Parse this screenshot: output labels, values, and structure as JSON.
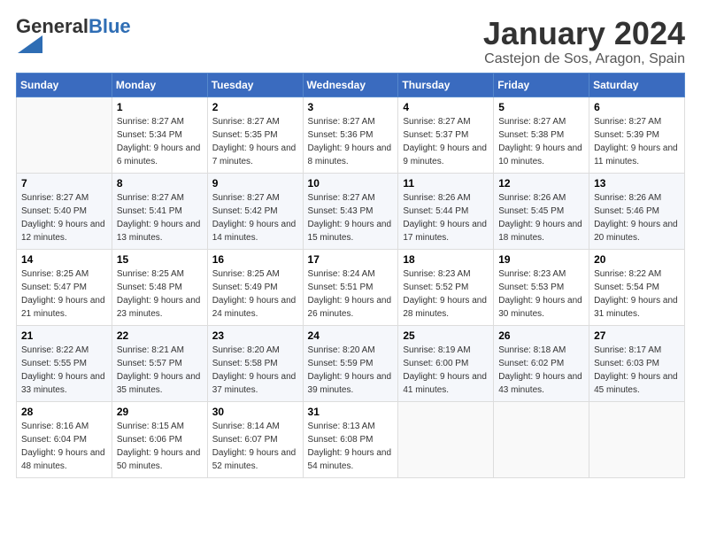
{
  "header": {
    "logo_general": "General",
    "logo_blue": "Blue",
    "title": "January 2024",
    "location": "Castejon de Sos, Aragon, Spain"
  },
  "weekdays": [
    "Sunday",
    "Monday",
    "Tuesday",
    "Wednesday",
    "Thursday",
    "Friday",
    "Saturday"
  ],
  "weeks": [
    [
      {
        "num": "",
        "sunrise": "",
        "sunset": "",
        "daylight": ""
      },
      {
        "num": "1",
        "sunrise": "Sunrise: 8:27 AM",
        "sunset": "Sunset: 5:34 PM",
        "daylight": "Daylight: 9 hours and 6 minutes."
      },
      {
        "num": "2",
        "sunrise": "Sunrise: 8:27 AM",
        "sunset": "Sunset: 5:35 PM",
        "daylight": "Daylight: 9 hours and 7 minutes."
      },
      {
        "num": "3",
        "sunrise": "Sunrise: 8:27 AM",
        "sunset": "Sunset: 5:36 PM",
        "daylight": "Daylight: 9 hours and 8 minutes."
      },
      {
        "num": "4",
        "sunrise": "Sunrise: 8:27 AM",
        "sunset": "Sunset: 5:37 PM",
        "daylight": "Daylight: 9 hours and 9 minutes."
      },
      {
        "num": "5",
        "sunrise": "Sunrise: 8:27 AM",
        "sunset": "Sunset: 5:38 PM",
        "daylight": "Daylight: 9 hours and 10 minutes."
      },
      {
        "num": "6",
        "sunrise": "Sunrise: 8:27 AM",
        "sunset": "Sunset: 5:39 PM",
        "daylight": "Daylight: 9 hours and 11 minutes."
      }
    ],
    [
      {
        "num": "7",
        "sunrise": "Sunrise: 8:27 AM",
        "sunset": "Sunset: 5:40 PM",
        "daylight": "Daylight: 9 hours and 12 minutes."
      },
      {
        "num": "8",
        "sunrise": "Sunrise: 8:27 AM",
        "sunset": "Sunset: 5:41 PM",
        "daylight": "Daylight: 9 hours and 13 minutes."
      },
      {
        "num": "9",
        "sunrise": "Sunrise: 8:27 AM",
        "sunset": "Sunset: 5:42 PM",
        "daylight": "Daylight: 9 hours and 14 minutes."
      },
      {
        "num": "10",
        "sunrise": "Sunrise: 8:27 AM",
        "sunset": "Sunset: 5:43 PM",
        "daylight": "Daylight: 9 hours and 15 minutes."
      },
      {
        "num": "11",
        "sunrise": "Sunrise: 8:26 AM",
        "sunset": "Sunset: 5:44 PM",
        "daylight": "Daylight: 9 hours and 17 minutes."
      },
      {
        "num": "12",
        "sunrise": "Sunrise: 8:26 AM",
        "sunset": "Sunset: 5:45 PM",
        "daylight": "Daylight: 9 hours and 18 minutes."
      },
      {
        "num": "13",
        "sunrise": "Sunrise: 8:26 AM",
        "sunset": "Sunset: 5:46 PM",
        "daylight": "Daylight: 9 hours and 20 minutes."
      }
    ],
    [
      {
        "num": "14",
        "sunrise": "Sunrise: 8:25 AM",
        "sunset": "Sunset: 5:47 PM",
        "daylight": "Daylight: 9 hours and 21 minutes."
      },
      {
        "num": "15",
        "sunrise": "Sunrise: 8:25 AM",
        "sunset": "Sunset: 5:48 PM",
        "daylight": "Daylight: 9 hours and 23 minutes."
      },
      {
        "num": "16",
        "sunrise": "Sunrise: 8:25 AM",
        "sunset": "Sunset: 5:49 PM",
        "daylight": "Daylight: 9 hours and 24 minutes."
      },
      {
        "num": "17",
        "sunrise": "Sunrise: 8:24 AM",
        "sunset": "Sunset: 5:51 PM",
        "daylight": "Daylight: 9 hours and 26 minutes."
      },
      {
        "num": "18",
        "sunrise": "Sunrise: 8:23 AM",
        "sunset": "Sunset: 5:52 PM",
        "daylight": "Daylight: 9 hours and 28 minutes."
      },
      {
        "num": "19",
        "sunrise": "Sunrise: 8:23 AM",
        "sunset": "Sunset: 5:53 PM",
        "daylight": "Daylight: 9 hours and 30 minutes."
      },
      {
        "num": "20",
        "sunrise": "Sunrise: 8:22 AM",
        "sunset": "Sunset: 5:54 PM",
        "daylight": "Daylight: 9 hours and 31 minutes."
      }
    ],
    [
      {
        "num": "21",
        "sunrise": "Sunrise: 8:22 AM",
        "sunset": "Sunset: 5:55 PM",
        "daylight": "Daylight: 9 hours and 33 minutes."
      },
      {
        "num": "22",
        "sunrise": "Sunrise: 8:21 AM",
        "sunset": "Sunset: 5:57 PM",
        "daylight": "Daylight: 9 hours and 35 minutes."
      },
      {
        "num": "23",
        "sunrise": "Sunrise: 8:20 AM",
        "sunset": "Sunset: 5:58 PM",
        "daylight": "Daylight: 9 hours and 37 minutes."
      },
      {
        "num": "24",
        "sunrise": "Sunrise: 8:20 AM",
        "sunset": "Sunset: 5:59 PM",
        "daylight": "Daylight: 9 hours and 39 minutes."
      },
      {
        "num": "25",
        "sunrise": "Sunrise: 8:19 AM",
        "sunset": "Sunset: 6:00 PM",
        "daylight": "Daylight: 9 hours and 41 minutes."
      },
      {
        "num": "26",
        "sunrise": "Sunrise: 8:18 AM",
        "sunset": "Sunset: 6:02 PM",
        "daylight": "Daylight: 9 hours and 43 minutes."
      },
      {
        "num": "27",
        "sunrise": "Sunrise: 8:17 AM",
        "sunset": "Sunset: 6:03 PM",
        "daylight": "Daylight: 9 hours and 45 minutes."
      }
    ],
    [
      {
        "num": "28",
        "sunrise": "Sunrise: 8:16 AM",
        "sunset": "Sunset: 6:04 PM",
        "daylight": "Daylight: 9 hours and 48 minutes."
      },
      {
        "num": "29",
        "sunrise": "Sunrise: 8:15 AM",
        "sunset": "Sunset: 6:06 PM",
        "daylight": "Daylight: 9 hours and 50 minutes."
      },
      {
        "num": "30",
        "sunrise": "Sunrise: 8:14 AM",
        "sunset": "Sunset: 6:07 PM",
        "daylight": "Daylight: 9 hours and 52 minutes."
      },
      {
        "num": "31",
        "sunrise": "Sunrise: 8:13 AM",
        "sunset": "Sunset: 6:08 PM",
        "daylight": "Daylight: 9 hours and 54 minutes."
      },
      {
        "num": "",
        "sunrise": "",
        "sunset": "",
        "daylight": ""
      },
      {
        "num": "",
        "sunrise": "",
        "sunset": "",
        "daylight": ""
      },
      {
        "num": "",
        "sunrise": "",
        "sunset": "",
        "daylight": ""
      }
    ]
  ]
}
